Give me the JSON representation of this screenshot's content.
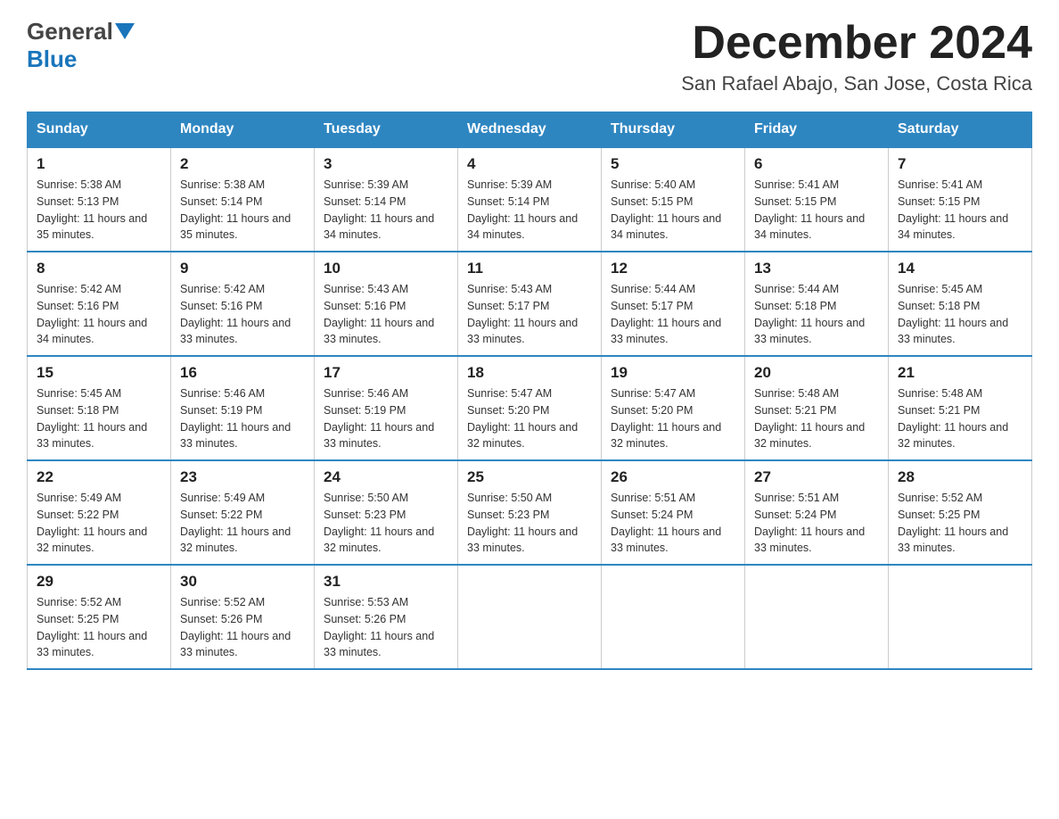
{
  "header": {
    "logo_general": "General",
    "logo_blue": "Blue",
    "month_title": "December 2024",
    "location": "San Rafael Abajo, San Jose, Costa Rica"
  },
  "weekdays": [
    "Sunday",
    "Monday",
    "Tuesday",
    "Wednesday",
    "Thursday",
    "Friday",
    "Saturday"
  ],
  "weeks": [
    [
      {
        "day": "1",
        "sunrise": "Sunrise: 5:38 AM",
        "sunset": "Sunset: 5:13 PM",
        "daylight": "Daylight: 11 hours and 35 minutes."
      },
      {
        "day": "2",
        "sunrise": "Sunrise: 5:38 AM",
        "sunset": "Sunset: 5:14 PM",
        "daylight": "Daylight: 11 hours and 35 minutes."
      },
      {
        "day": "3",
        "sunrise": "Sunrise: 5:39 AM",
        "sunset": "Sunset: 5:14 PM",
        "daylight": "Daylight: 11 hours and 34 minutes."
      },
      {
        "day": "4",
        "sunrise": "Sunrise: 5:39 AM",
        "sunset": "Sunset: 5:14 PM",
        "daylight": "Daylight: 11 hours and 34 minutes."
      },
      {
        "day": "5",
        "sunrise": "Sunrise: 5:40 AM",
        "sunset": "Sunset: 5:15 PM",
        "daylight": "Daylight: 11 hours and 34 minutes."
      },
      {
        "day": "6",
        "sunrise": "Sunrise: 5:41 AM",
        "sunset": "Sunset: 5:15 PM",
        "daylight": "Daylight: 11 hours and 34 minutes."
      },
      {
        "day": "7",
        "sunrise": "Sunrise: 5:41 AM",
        "sunset": "Sunset: 5:15 PM",
        "daylight": "Daylight: 11 hours and 34 minutes."
      }
    ],
    [
      {
        "day": "8",
        "sunrise": "Sunrise: 5:42 AM",
        "sunset": "Sunset: 5:16 PM",
        "daylight": "Daylight: 11 hours and 34 minutes."
      },
      {
        "day": "9",
        "sunrise": "Sunrise: 5:42 AM",
        "sunset": "Sunset: 5:16 PM",
        "daylight": "Daylight: 11 hours and 33 minutes."
      },
      {
        "day": "10",
        "sunrise": "Sunrise: 5:43 AM",
        "sunset": "Sunset: 5:16 PM",
        "daylight": "Daylight: 11 hours and 33 minutes."
      },
      {
        "day": "11",
        "sunrise": "Sunrise: 5:43 AM",
        "sunset": "Sunset: 5:17 PM",
        "daylight": "Daylight: 11 hours and 33 minutes."
      },
      {
        "day": "12",
        "sunrise": "Sunrise: 5:44 AM",
        "sunset": "Sunset: 5:17 PM",
        "daylight": "Daylight: 11 hours and 33 minutes."
      },
      {
        "day": "13",
        "sunrise": "Sunrise: 5:44 AM",
        "sunset": "Sunset: 5:18 PM",
        "daylight": "Daylight: 11 hours and 33 minutes."
      },
      {
        "day": "14",
        "sunrise": "Sunrise: 5:45 AM",
        "sunset": "Sunset: 5:18 PM",
        "daylight": "Daylight: 11 hours and 33 minutes."
      }
    ],
    [
      {
        "day": "15",
        "sunrise": "Sunrise: 5:45 AM",
        "sunset": "Sunset: 5:18 PM",
        "daylight": "Daylight: 11 hours and 33 minutes."
      },
      {
        "day": "16",
        "sunrise": "Sunrise: 5:46 AM",
        "sunset": "Sunset: 5:19 PM",
        "daylight": "Daylight: 11 hours and 33 minutes."
      },
      {
        "day": "17",
        "sunrise": "Sunrise: 5:46 AM",
        "sunset": "Sunset: 5:19 PM",
        "daylight": "Daylight: 11 hours and 33 minutes."
      },
      {
        "day": "18",
        "sunrise": "Sunrise: 5:47 AM",
        "sunset": "Sunset: 5:20 PM",
        "daylight": "Daylight: 11 hours and 32 minutes."
      },
      {
        "day": "19",
        "sunrise": "Sunrise: 5:47 AM",
        "sunset": "Sunset: 5:20 PM",
        "daylight": "Daylight: 11 hours and 32 minutes."
      },
      {
        "day": "20",
        "sunrise": "Sunrise: 5:48 AM",
        "sunset": "Sunset: 5:21 PM",
        "daylight": "Daylight: 11 hours and 32 minutes."
      },
      {
        "day": "21",
        "sunrise": "Sunrise: 5:48 AM",
        "sunset": "Sunset: 5:21 PM",
        "daylight": "Daylight: 11 hours and 32 minutes."
      }
    ],
    [
      {
        "day": "22",
        "sunrise": "Sunrise: 5:49 AM",
        "sunset": "Sunset: 5:22 PM",
        "daylight": "Daylight: 11 hours and 32 minutes."
      },
      {
        "day": "23",
        "sunrise": "Sunrise: 5:49 AM",
        "sunset": "Sunset: 5:22 PM",
        "daylight": "Daylight: 11 hours and 32 minutes."
      },
      {
        "day": "24",
        "sunrise": "Sunrise: 5:50 AM",
        "sunset": "Sunset: 5:23 PM",
        "daylight": "Daylight: 11 hours and 32 minutes."
      },
      {
        "day": "25",
        "sunrise": "Sunrise: 5:50 AM",
        "sunset": "Sunset: 5:23 PM",
        "daylight": "Daylight: 11 hours and 33 minutes."
      },
      {
        "day": "26",
        "sunrise": "Sunrise: 5:51 AM",
        "sunset": "Sunset: 5:24 PM",
        "daylight": "Daylight: 11 hours and 33 minutes."
      },
      {
        "day": "27",
        "sunrise": "Sunrise: 5:51 AM",
        "sunset": "Sunset: 5:24 PM",
        "daylight": "Daylight: 11 hours and 33 minutes."
      },
      {
        "day": "28",
        "sunrise": "Sunrise: 5:52 AM",
        "sunset": "Sunset: 5:25 PM",
        "daylight": "Daylight: 11 hours and 33 minutes."
      }
    ],
    [
      {
        "day": "29",
        "sunrise": "Sunrise: 5:52 AM",
        "sunset": "Sunset: 5:25 PM",
        "daylight": "Daylight: 11 hours and 33 minutes."
      },
      {
        "day": "30",
        "sunrise": "Sunrise: 5:52 AM",
        "sunset": "Sunset: 5:26 PM",
        "daylight": "Daylight: 11 hours and 33 minutes."
      },
      {
        "day": "31",
        "sunrise": "Sunrise: 5:53 AM",
        "sunset": "Sunset: 5:26 PM",
        "daylight": "Daylight: 11 hours and 33 minutes."
      },
      null,
      null,
      null,
      null
    ]
  ]
}
